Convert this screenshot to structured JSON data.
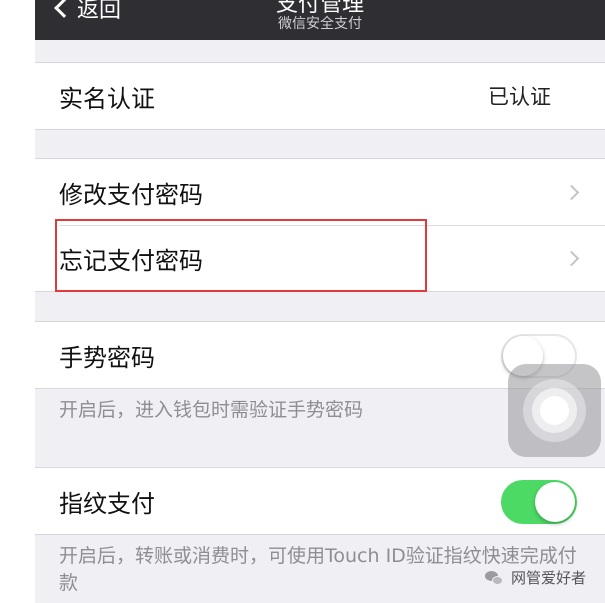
{
  "navbar": {
    "back_label": "返回",
    "title": "支付管理",
    "subtitle": "微信安全支付"
  },
  "sections": {
    "realname": {
      "label": "实名认证",
      "value": "已认证"
    },
    "change_password": {
      "label": "修改支付密码"
    },
    "forgot_password": {
      "label": "忘记支付密码"
    },
    "gesture": {
      "label": "手势密码",
      "enabled": false,
      "footnote": "开启后，进入钱包时需验证手势密码"
    },
    "fingerprint": {
      "label": "指纹支付",
      "enabled": true,
      "footnote": "开启后，转账或消费时，可使用Touch ID验证指纹快速完成付款"
    }
  },
  "watermark": {
    "text": "网管爱好者"
  },
  "colors": {
    "navbar": "#2e2e33",
    "toggle_on": "#4cd964",
    "highlight_box": "#e03a3a",
    "background": "#efeff4"
  }
}
